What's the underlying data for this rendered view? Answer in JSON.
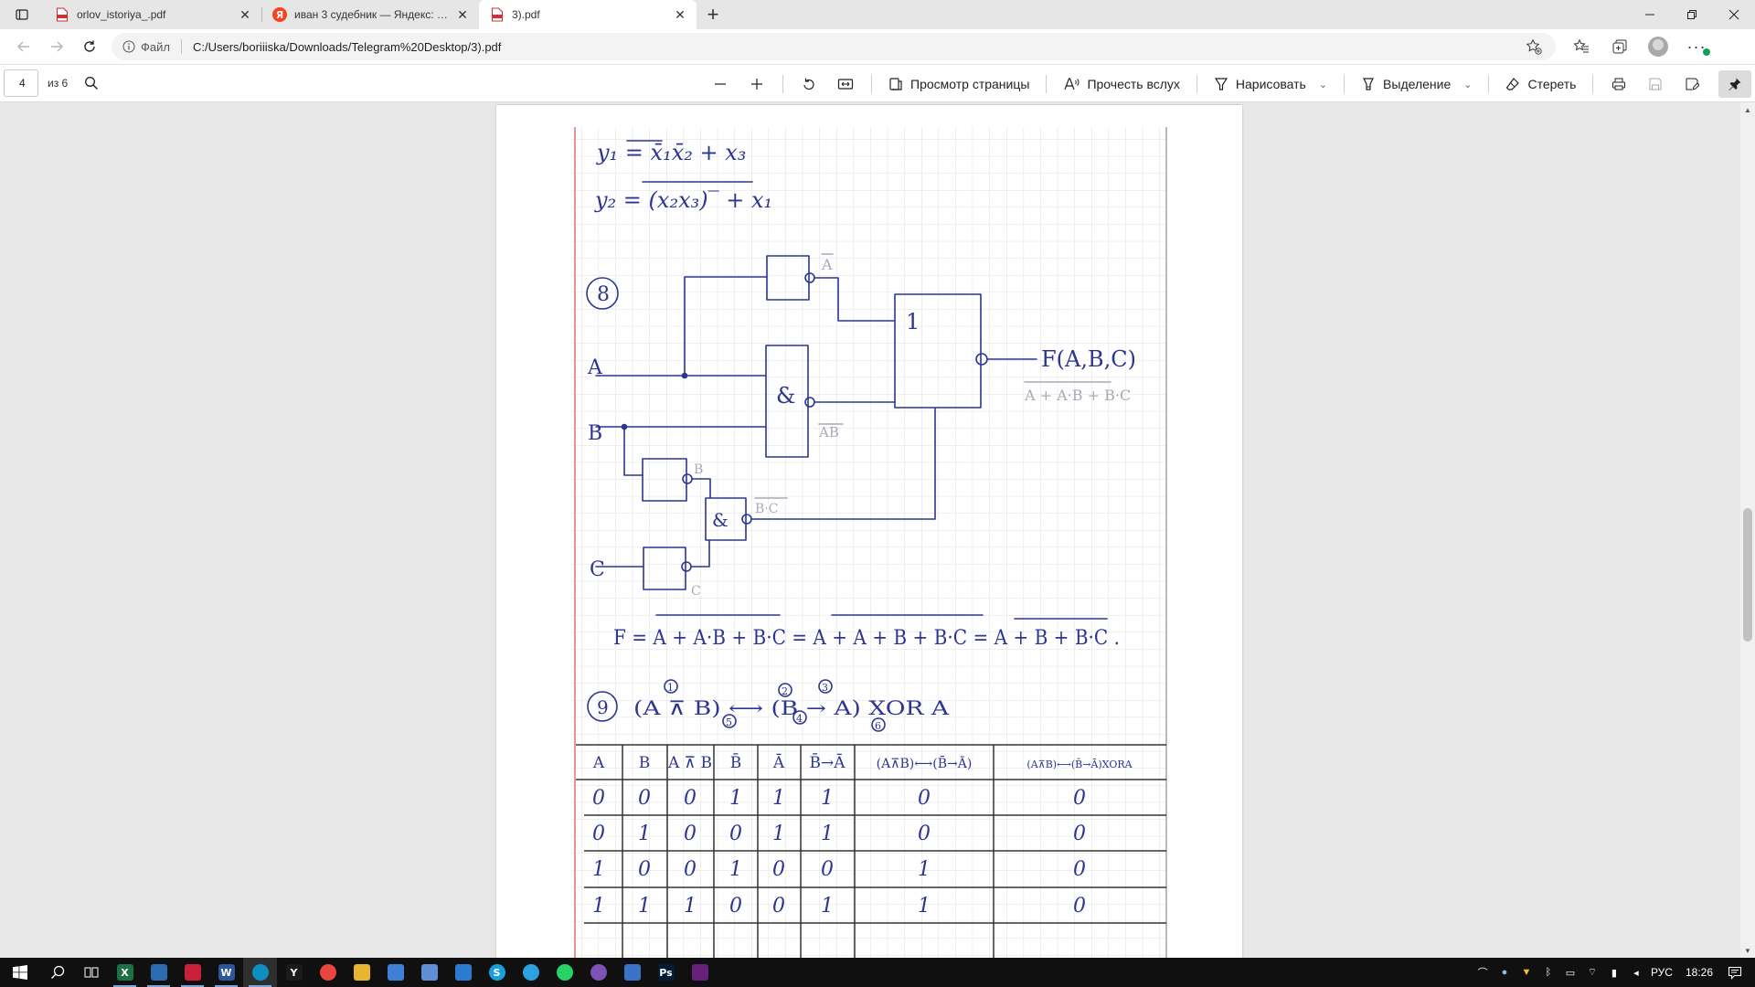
{
  "browser": {
    "tabs": [
      {
        "title": "orlov_istoriya_.pdf",
        "icon": "pdf-icon",
        "active": false
      },
      {
        "title": "иван 3 судебник — Яндекс: нашлось 3 млн результатов",
        "icon": "yandex-icon",
        "active": false
      },
      {
        "title": "3).pdf",
        "icon": "pdf-icon",
        "active": true
      }
    ],
    "address": {
      "scheme_label": "Файл",
      "url": "C:/Users/boriiiska/Downloads/Telegram%20Desktop/3).pdf"
    }
  },
  "pdf_toolbar": {
    "page_number": "4",
    "page_count": "из 6",
    "page_view_label": "Просмотр страницы",
    "read_aloud_label": "Прочесть вслух",
    "draw_label": "Нарисовать",
    "highlight_label": "Выделение",
    "erase_label": "Стереть"
  },
  "document": {
    "equations": {
      "y1": "y₁ = x̄₁x̄₂ + x₃",
      "y2": "y₂ = (x₂x₃)‾ + x₁"
    },
    "task8": {
      "number": "8",
      "input_a": "A",
      "input_b": "B",
      "input_c": "C",
      "gate_or_label": "1",
      "gate_and_label": "&",
      "not_a_label": "A",
      "not_ab_label": "AB",
      "not_b_label": "B",
      "not_bc_label": "B·C",
      "not_c_label": "C",
      "output_label": "F(A,B,C)",
      "output_expression": "A + A·B + B·C",
      "derivation": "F = A + A·B + B·C = A + A + B + B·C = A + B + B·C ."
    },
    "task9": {
      "number": "9",
      "expression": "(A ⊼ B) ⟷ (B → A) XOR A",
      "step_marks": [
        "1",
        "2",
        "3",
        "4",
        "5",
        "6"
      ],
      "table": {
        "headers": [
          "A",
          "B",
          "A ⊼ B",
          "B̄",
          "Ā",
          "B̄→Ā",
          "(A⊼B)⟷(B̄→Ā)",
          "(A⊼B)⟷(B̄→Ā)XORA"
        ],
        "rows": [
          [
            "0",
            "0",
            "0",
            "1",
            "1",
            "1",
            "0",
            "0"
          ],
          [
            "0",
            "1",
            "0",
            "0",
            "1",
            "1",
            "0",
            "0"
          ],
          [
            "1",
            "0",
            "0",
            "1",
            "0",
            "0",
            "1",
            "0"
          ],
          [
            "1",
            "1",
            "1",
            "0",
            "0",
            "1",
            "1",
            "0"
          ]
        ]
      }
    }
  },
  "taskbar": {
    "apps": [
      {
        "name": "task-view",
        "glyph": ""
      },
      {
        "name": "excel",
        "glyph": "X",
        "color": "#1d7044"
      },
      {
        "name": "app-blue",
        "glyph": "",
        "color": "#2b6cb0"
      },
      {
        "name": "app-red",
        "glyph": "",
        "color": "#c9213a"
      },
      {
        "name": "word",
        "glyph": "W",
        "color": "#2b579a"
      },
      {
        "name": "edge",
        "glyph": "",
        "color": "#0f8fbf"
      },
      {
        "name": "yandex-browser",
        "glyph": "Y",
        "color": "#1b1b1b"
      },
      {
        "name": "chrome",
        "glyph": "",
        "color": "#e8453c"
      },
      {
        "name": "file-explorer",
        "glyph": "",
        "color": "#e8b530"
      },
      {
        "name": "store",
        "glyph": "",
        "color": "#3f7fd8"
      },
      {
        "name": "photos",
        "glyph": "",
        "color": "#5f8ed6"
      },
      {
        "name": "mail",
        "glyph": "",
        "color": "#2d7bd0"
      },
      {
        "name": "skype",
        "glyph": "S",
        "color": "#1a9ee0"
      },
      {
        "name": "telegram",
        "glyph": "",
        "color": "#2aa3e0"
      },
      {
        "name": "whatsapp",
        "glyph": "",
        "color": "#25d366"
      },
      {
        "name": "viber",
        "glyph": "",
        "color": "#7d51b5"
      },
      {
        "name": "app-blue-2",
        "glyph": "",
        "color": "#3a72c8"
      },
      {
        "name": "photoshop",
        "glyph": "Ps",
        "color": "#001d34"
      },
      {
        "name": "visual-studio",
        "glyph": "",
        "color": "#68217a"
      }
    ],
    "tray": {
      "language": "РУС",
      "time": "18:26"
    }
  },
  "colors": {
    "tabstrip": "#e6e6e6",
    "viewer_background": "#e8e8e8",
    "ink": "#2c3592",
    "grid": "#d4d4d4",
    "margin_line": "#e07b7b",
    "taskbar": "#101010"
  }
}
